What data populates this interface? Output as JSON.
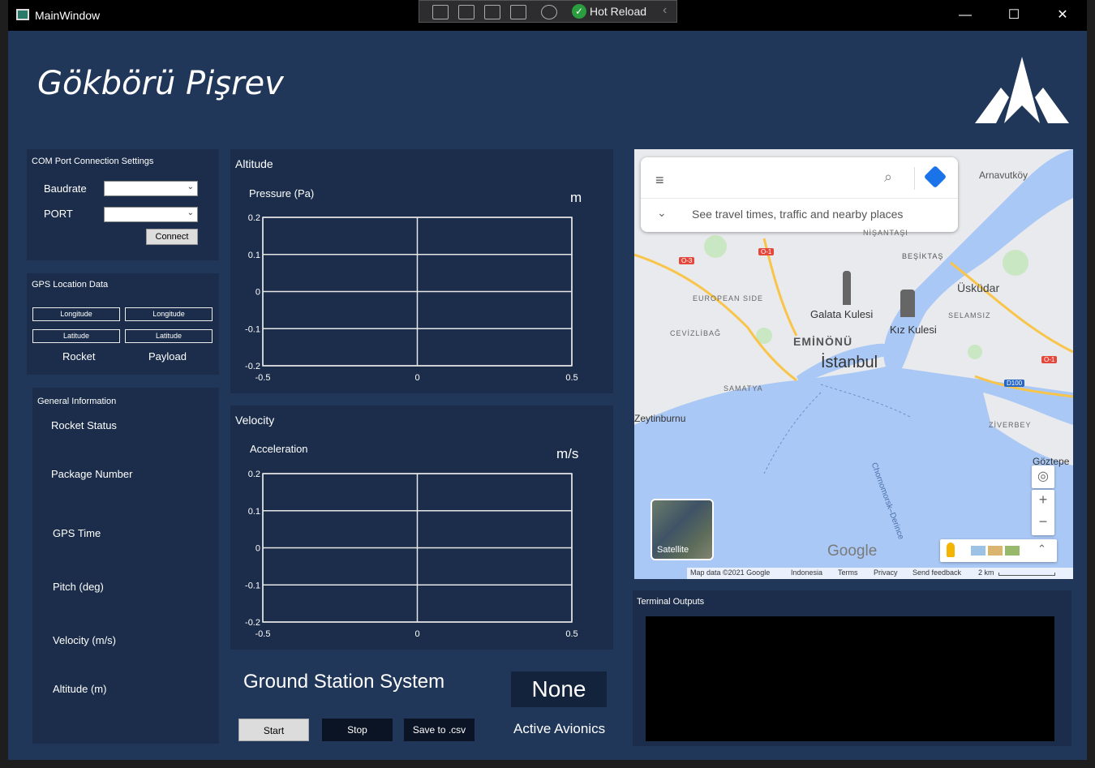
{
  "window": {
    "title": "MainWindow",
    "controls": {
      "minimize": "—",
      "maximize": "☐",
      "close": "✕"
    }
  },
  "hot_reload": {
    "label": "Hot Reload"
  },
  "app": {
    "title": "Gökbörü Pişrev",
    "logo_icon": "arrow-logo-icon"
  },
  "com_port": {
    "title": "COM Port Connection Settings",
    "baudrate_label": "Baudrate",
    "baudrate_value": "",
    "port_label": "PORT",
    "port_value": "",
    "connect_label": "Connect"
  },
  "gps": {
    "title": "GPS Location Data",
    "rocket": {
      "longitude": "Longitude",
      "latitude": "Latitude",
      "label": "Rocket"
    },
    "payload": {
      "longitude": "Longitude",
      "latitude": "Latitude",
      "label": "Payload"
    }
  },
  "general": {
    "title": "General Information",
    "items": [
      "Rocket Status",
      "Package Number",
      "GPS Time",
      "Pitch (deg)",
      "Velocity (m/s)",
      "Altitude (m)"
    ]
  },
  "charts": {
    "altitude": {
      "title": "Altitude",
      "subtitle": "Pressure (Pa)",
      "unit": "m"
    },
    "velocity": {
      "title": "Velocity",
      "subtitle": "Acceleration",
      "unit": "m/s"
    }
  },
  "chart_data": [
    {
      "type": "line",
      "title": "Pressure (Pa)",
      "xlabel": "",
      "ylabel": "",
      "xlim": [
        -0.5,
        0.5
      ],
      "ylim": [
        -0.2,
        0.2
      ],
      "xticks": [
        "-0.5",
        "0",
        "0.5"
      ],
      "yticks": [
        "0.2",
        "0.1",
        "0",
        "-0.1",
        "-0.2"
      ],
      "grid": true,
      "series": []
    },
    {
      "type": "line",
      "title": "Acceleration",
      "xlabel": "",
      "ylabel": "",
      "xlim": [
        -0.5,
        0.5
      ],
      "ylim": [
        -0.2,
        0.2
      ],
      "xticks": [
        "-0.5",
        "0",
        "0.5"
      ],
      "yticks": [
        "0.2",
        "0.1",
        "0",
        "-0.1",
        "-0.2"
      ],
      "grid": true,
      "series": []
    }
  ],
  "map": {
    "search_placeholder": "",
    "suggestion": "See travel times, traffic and nearby places",
    "places": [
      "Arnavutköy",
      "NİŞANTAŞI",
      "BEŞİKTAŞ",
      "Üsküdar",
      "EUROPEAN SIDE",
      "Galata Kulesi",
      "Kız Kulesi",
      "SELAMSIZ",
      "CEVİZLİBAĞ",
      "EMİNÖNÜ",
      "İstanbul",
      "SAMATYA",
      "Zeytinburnu",
      "ZİVERBEY",
      "Göztepe",
      "Chornomorsk–Derince"
    ],
    "roads": [
      "O-3",
      "O-1",
      "O-1",
      "D100"
    ],
    "satellite_label": "Satellite",
    "logo": "Google",
    "attribution": [
      "Map data ©2021 Google",
      "Indonesia",
      "Terms",
      "Privacy",
      "Send feedback",
      "2 km"
    ],
    "zoom_in": "+",
    "zoom_out": "−"
  },
  "terminal": {
    "title": "Terminal Outputs"
  },
  "ground_station": {
    "title": "Ground Station System",
    "status_value": "None",
    "status_label": "Active Avionics",
    "start_label": "Start",
    "stop_label": "Stop",
    "save_label": "Save to .csv"
  },
  "colors": {
    "background": "#203759",
    "panel": "#1b2d4a",
    "water": "#aac8f5",
    "land": "#e8eaed"
  }
}
